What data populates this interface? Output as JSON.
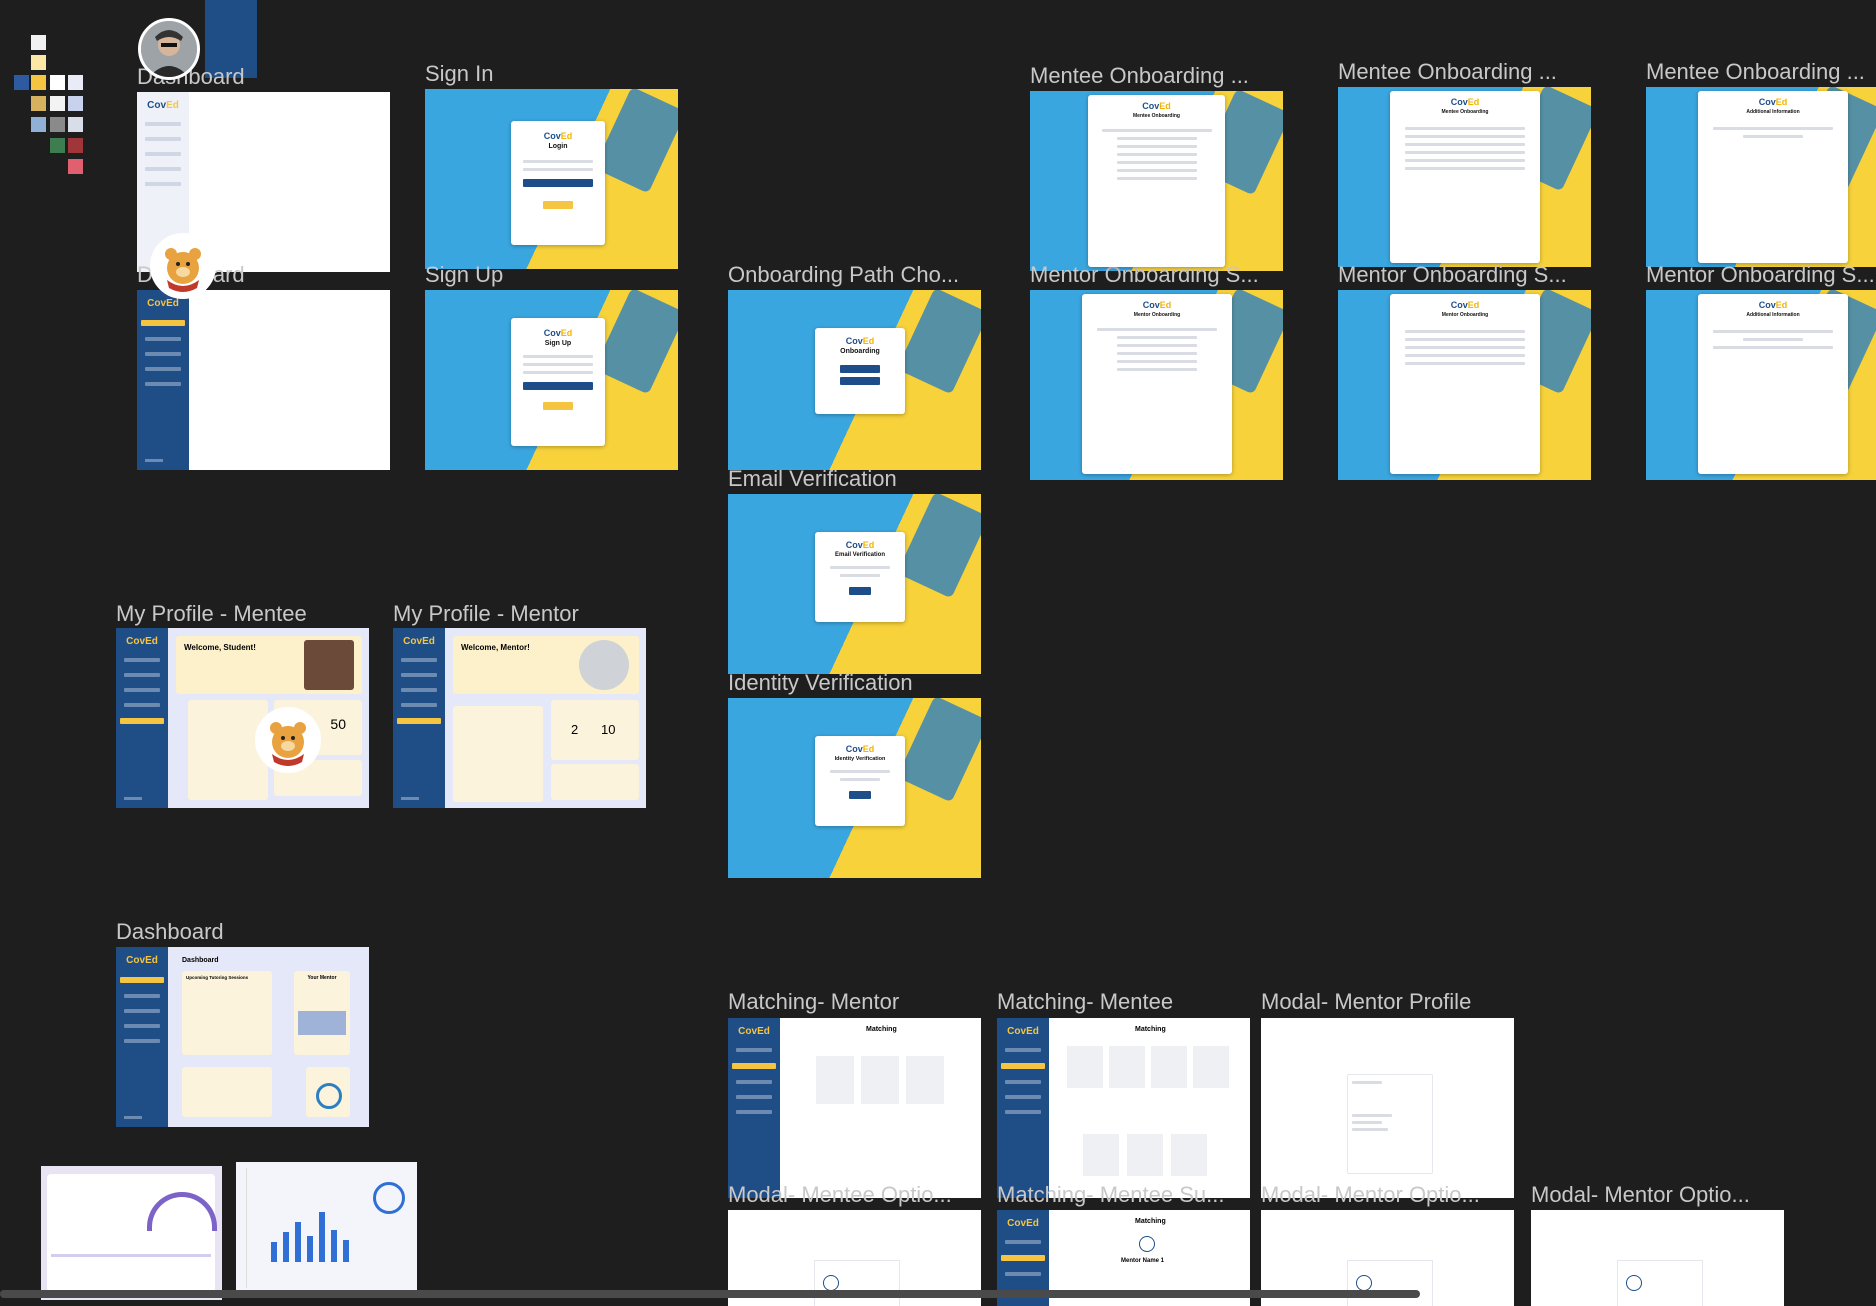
{
  "canvas": {
    "labels": {
      "dashboard_1": "Dashboard",
      "dashboard_2": "Dashboard",
      "sign_in": "Sign In",
      "sign_up": "Sign Up",
      "mentee_onboarding_1": "Mentee Onboarding ...",
      "mentee_onboarding_2": "Mentee Onboarding ...",
      "mentee_onboarding_3": "Mentee Onboarding ...",
      "onboarding_path": "Onboarding Path Cho...",
      "mentor_onboarding_1": "Mentor Onboarding S...",
      "mentor_onboarding_2": "Mentor Onboarding S...",
      "mentor_onboarding_3": "Mentor Onboarding S...",
      "email_verification": "Email Verification",
      "identity_verification": "Identity Verification",
      "my_profile_mentee": "My Profile - Mentee",
      "my_profile_mentor": "My Profile - Mentor",
      "dashboard_3": "Dashboard",
      "matching_mentor": "Matching- Mentor",
      "matching_mentee": "Matching- Mentee",
      "modal_mentor_profile": "Modal- Mentor Profile",
      "modal_mentee_option": "Modal- Mentee Optio...",
      "matching_mentee_2": "Matching- Mentee Su...",
      "modal_mentor_option_1": "Modal- Mentor Optio...",
      "modal_mentor_option_2": "Modal- Mentor Optio..."
    },
    "frame_text": {
      "logo_main": "Cov",
      "logo_accent": "Ed",
      "login": "Login",
      "sign_up": "Sign Up",
      "onboarding": "Onboarding",
      "email_verification": "Email Verification",
      "identity_verification": "Identity Verification",
      "mentee_onboarding": "Mentee Onboarding",
      "mentor_onboarding": "Mentor Onboarding",
      "additional_information": "Additional Information",
      "welcome_student": "Welcome, Student!",
      "welcome_mentor": "Welcome, Mentor!",
      "dashboard": "Dashboard",
      "upcoming_sessions": "Upcoming Tutoring Sessions",
      "your_mentor": "Your Mentor",
      "matching": "Matching",
      "mentor_name": "Mentor Name 1",
      "stat_50": "50",
      "stat_2": "2",
      "stat_10": "10"
    },
    "colors": {
      "canvas_bg": "#1e1e1e",
      "brand_blue": "#1f4d86",
      "brand_yellow": "#f5c542",
      "art_blue": "#3aa6e0",
      "art_yellow": "#f7d23a"
    },
    "swatches": [
      "#f1f1f1",
      "#fde7a6",
      "#f5c542",
      "#ffffff",
      "#e9ecf7",
      "#2d5aa0",
      "#d6b25e",
      "#f3f3f3",
      "#c8d2ef",
      "#90b0d6",
      "#8a8a8a",
      "#d9dde8",
      "#3e7d4f",
      "#a0353a",
      "#e06070"
    ]
  }
}
